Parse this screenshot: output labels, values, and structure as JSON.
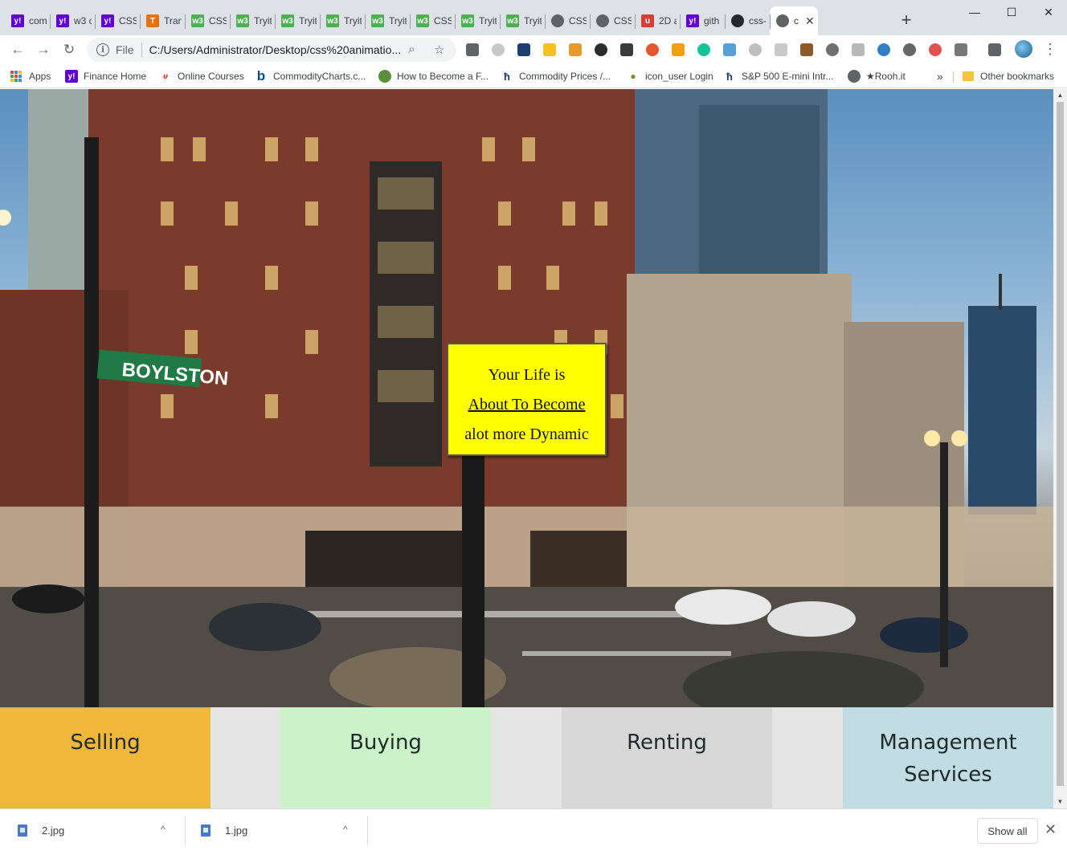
{
  "browser": {
    "tabs": [
      {
        "title": "com",
        "icon": "yahoo-icon",
        "color": "#6001d2"
      },
      {
        "title": "w3 c",
        "icon": "yahoo-icon",
        "color": "#6001d2"
      },
      {
        "title": "CSS",
        "icon": "yahoo-icon",
        "color": "#6001d2"
      },
      {
        "title": "Tran",
        "icon": "translate-icon",
        "color": "#e8710a"
      },
      {
        "title": "CSS",
        "icon": "w3schools-icon",
        "color": "#4caf50"
      },
      {
        "title": "Tryit",
        "icon": "w3schools-icon",
        "color": "#4caf50"
      },
      {
        "title": "Tryit",
        "icon": "w3schools-icon",
        "color": "#4caf50"
      },
      {
        "title": "Tryit",
        "icon": "w3schools-icon",
        "color": "#4caf50"
      },
      {
        "title": "Tryit",
        "icon": "w3schools-icon",
        "color": "#4caf50"
      },
      {
        "title": "CSS",
        "icon": "w3schools-icon",
        "color": "#4caf50"
      },
      {
        "title": "Tryit",
        "icon": "w3schools-icon",
        "color": "#4caf50"
      },
      {
        "title": "Tryit",
        "icon": "w3schools-icon",
        "color": "#4caf50"
      },
      {
        "title": "CSS",
        "icon": "globe-icon",
        "color": "#5f6368"
      },
      {
        "title": "CSS",
        "icon": "globe-icon",
        "color": "#5f6368"
      },
      {
        "title": "2D a",
        "icon": "udemy-icon",
        "color": "#d63e39"
      },
      {
        "title": "gith",
        "icon": "yahoo-icon",
        "color": "#6001d2"
      },
      {
        "title": "css-",
        "icon": "github-icon",
        "color": "#24292e"
      }
    ],
    "active_tab": {
      "title": "c",
      "icon": "globe-icon",
      "close": "✕"
    },
    "new_tab": "+",
    "window": {
      "minimize": "—",
      "maximize": "☐",
      "close": "✕"
    }
  },
  "toolbar": {
    "back": "←",
    "forward": "→",
    "reload": "↻",
    "scheme": "File",
    "url": "C:/Users/Administrator/Desktop/css%20animatio...",
    "zoom_icon": "⌕",
    "star_icon": "☆",
    "menu": "⋮"
  },
  "bookmarks": [
    {
      "label": "Apps",
      "icon": "apps-grid-icon"
    },
    {
      "label": "Finance Home",
      "icon": "yahoo-icon",
      "color": "#6001d2"
    },
    {
      "label": "Online Courses",
      "icon": "udemy-icon",
      "color": "#d63e39"
    },
    {
      "label": "CommodityCharts.c...",
      "icon": "b-icon",
      "color": "#0b4c8c"
    },
    {
      "label": "How to Become a F...",
      "icon": "globe-icon",
      "color": "#5a8f3c"
    },
    {
      "label": "Commodity Prices /...",
      "icon": "barchart-icon",
      "color": "#1b3b6f"
    },
    {
      "label": "icon_user Login",
      "icon": "user-icon",
      "color": "#7a8b2f"
    },
    {
      "label": "S&P 500 E-mini Intr...",
      "icon": "barchart-icon",
      "color": "#1b3b6f"
    },
    {
      "label": "★Rooh.it",
      "icon": "globe-icon",
      "color": "#5f6368"
    }
  ],
  "bookmarks_overflow": "»",
  "other_bookmarks": "Other bookmarks",
  "page": {
    "callout": {
      "line1": "Your Life is",
      "line2": "About To Become",
      "line3": "alot more Dynamic"
    },
    "street_sign": "BOYLSTON",
    "services": [
      {
        "line1": "Selling",
        "line2": ""
      },
      {
        "line1": "Buying",
        "line2": ""
      },
      {
        "line1": "Renting",
        "line2": ""
      },
      {
        "line1": "Management",
        "line2": "Services"
      }
    ]
  },
  "downloads": {
    "items": [
      {
        "name": "2.jpg"
      },
      {
        "name": "1.jpg"
      }
    ],
    "caret": "^",
    "show_all": "Show all",
    "close": "✕"
  }
}
